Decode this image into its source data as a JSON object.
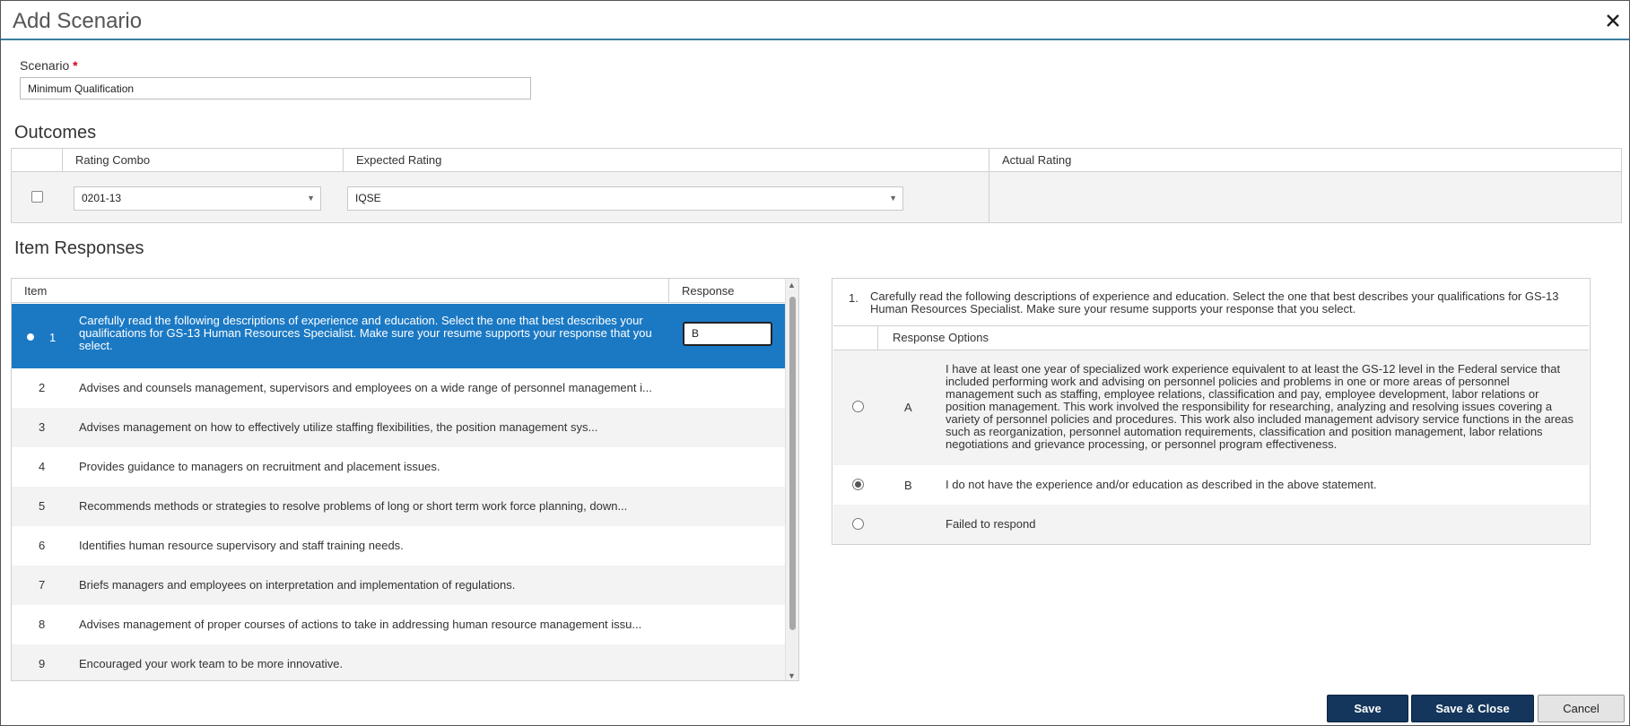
{
  "dialog": {
    "title": "Add Scenario"
  },
  "scenario": {
    "label": "Scenario",
    "required_mark": "*",
    "value": "Minimum Qualification"
  },
  "outcomes": {
    "heading": "Outcomes",
    "columns": [
      "Rating Combo",
      "Expected Rating",
      "Actual Rating"
    ],
    "row": {
      "rating_combo": "0201-13",
      "expected_rating": "IQSE",
      "actual_rating": ""
    }
  },
  "item_responses": {
    "heading": "Item Responses",
    "columns": {
      "item": "Item",
      "response": "Response"
    },
    "selected_response_value": "B",
    "items": [
      {
        "num": "1",
        "text": "Carefully read the following descriptions of experience and education. Select the one that best describes your qualifications for GS-13 Human Resources Specialist. Make sure your resume supports your response that you select."
      },
      {
        "num": "2",
        "text": "Advises and counsels management, supervisors and employees on a wide range of personnel management i..."
      },
      {
        "num": "3",
        "text": "Advises management on how to effectively utilize staffing flexibilities, the position management sys..."
      },
      {
        "num": "4",
        "text": "Provides guidance to managers on recruitment and placement issues."
      },
      {
        "num": "5",
        "text": "Recommends methods or strategies to resolve problems of long or short term work force planning, down..."
      },
      {
        "num": "6",
        "text": "Identifies human resource supervisory and staff training needs."
      },
      {
        "num": "7",
        "text": "Briefs managers and employees on interpretation and implementation of regulations."
      },
      {
        "num": "8",
        "text": "Advises management of proper courses of actions to take in addressing human resource management issu..."
      },
      {
        "num": "9",
        "text": "Encouraged your work team to be more innovative."
      }
    ]
  },
  "detail": {
    "question_number": "1.",
    "question_text": "Carefully read the following descriptions of experience and education. Select the one that best describes your qualifications for GS-13 Human Resources Specialist. Make sure your resume supports your response that you select.",
    "options_header": "Response Options",
    "options": [
      {
        "letter": "A",
        "text": "I have at least one year of specialized work experience equivalent to at least the GS-12 level in the Federal service that included performing work and advising on personnel policies and problems in one or more areas of personnel management such as staffing, employee relations, classification and pay, employee development, labor relations or position management. This work involved the responsibility for researching, analyzing and resolving issues covering a variety of personnel policies and procedures. This work also included management advisory service functions in the areas such as reorganization, personnel automation requirements, classification and position management, labor relations negotiations and grievance processing, or personnel program effectiveness.",
        "selected": false
      },
      {
        "letter": "B",
        "text": "I do not have the experience and/or education as described in the above statement.",
        "selected": true
      },
      {
        "letter": "",
        "text": "Failed to respond",
        "selected": false
      }
    ]
  },
  "footer": {
    "save": "Save",
    "save_close": "Save & Close",
    "cancel": "Cancel"
  }
}
